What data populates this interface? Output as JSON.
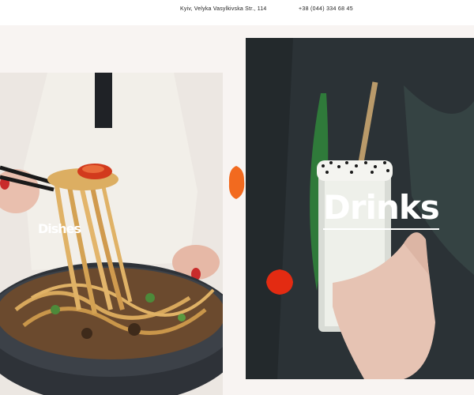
{
  "header": {
    "address": "Kyiv, Velyka Vasylkivska Str., 114",
    "phone": "+38 (044) 334 68 45"
  },
  "categories": [
    {
      "label": "Dishes"
    },
    {
      "label": "Drinks"
    }
  ],
  "colors": {
    "background": "#f8f4f2",
    "accent_orange": "#f26a1f",
    "accent_red": "#e32b12"
  }
}
